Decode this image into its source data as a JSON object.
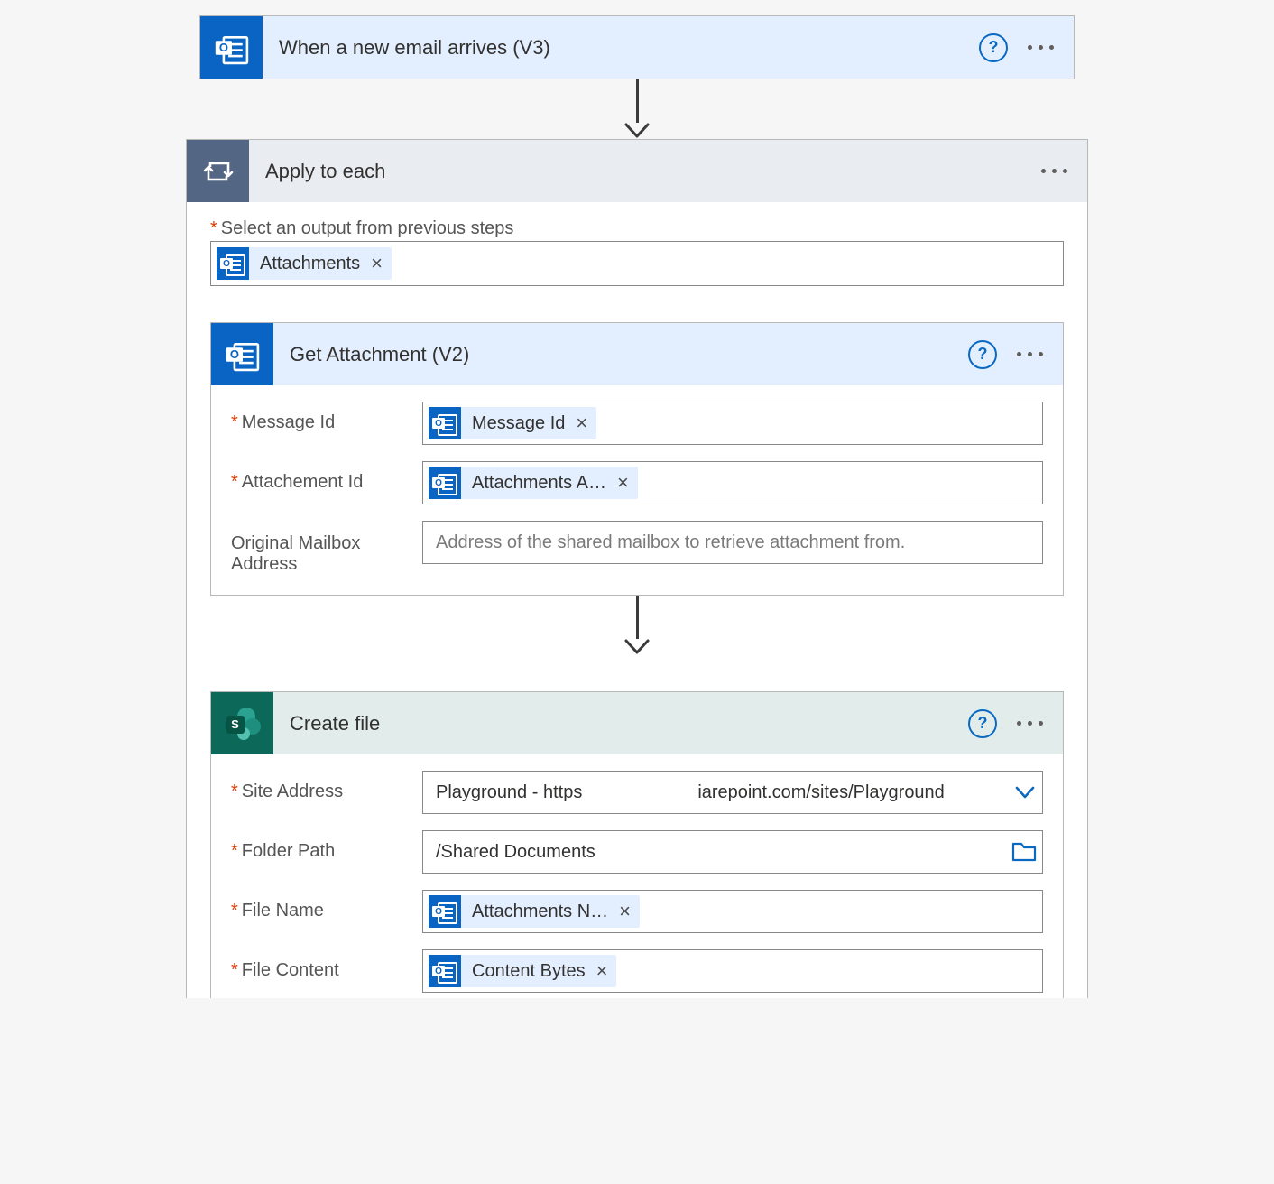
{
  "trigger": {
    "title": "When a new email arrives (V3)"
  },
  "apply_each": {
    "title": "Apply to each",
    "select_label": "Select an output from previous steps",
    "select_token": "Attachments"
  },
  "get_attachment": {
    "title": "Get Attachment (V2)",
    "rows": {
      "message_id": {
        "label": "Message Id",
        "token": "Message Id",
        "required": true
      },
      "attachment_id": {
        "label": "Attachement Id",
        "token": "Attachments A…",
        "required": true
      },
      "original_mailbox": {
        "label": "Original Mailbox Address",
        "placeholder": "Address of the shared mailbox to retrieve attachment from.",
        "required": false
      }
    }
  },
  "create_file": {
    "title": "Create file",
    "rows": {
      "site_address": {
        "label": "Site Address",
        "value_left": "Playground - https",
        "value_right": "iarepoint.com/sites/Playground",
        "required": true
      },
      "folder_path": {
        "label": "Folder Path",
        "value": "/Shared Documents",
        "required": true
      },
      "file_name": {
        "label": "File Name",
        "token": "Attachments N…",
        "required": true
      },
      "file_content": {
        "label": "File Content",
        "token": "Content Bytes",
        "required": true
      }
    }
  }
}
